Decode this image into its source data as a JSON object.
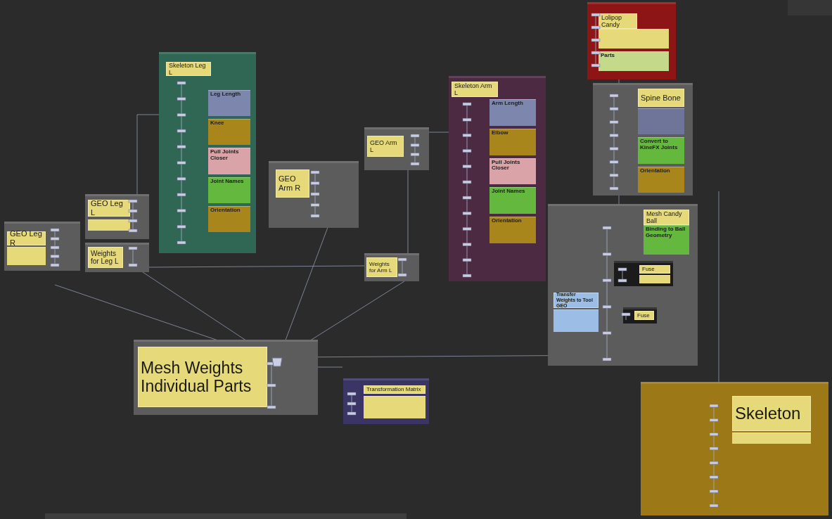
{
  "boxes": [
    {
      "kind": "frame",
      "title": "GEO Leg R",
      "color": "#5c5c5c",
      "notes": [
        {
          "color": "#e6d97a"
        }
      ]
    },
    {
      "kind": "frame",
      "title": "GEO Leg L",
      "color": "#5c5c5c",
      "notes": [
        {
          "color": "#e6d97a"
        }
      ]
    },
    {
      "kind": "frame",
      "title": "Weights for Leg L",
      "color": "#5c5c5c"
    },
    {
      "kind": "frame",
      "title": "Skeleton Leg L",
      "color": "#2f6654",
      "notes": [
        {
          "heading": "Leg Length",
          "color": "#7d86ad"
        },
        {
          "heading": "Knee",
          "color": "#a8861c"
        },
        {
          "heading": "Pull Joints Closer",
          "color": "#d9a3a8"
        },
        {
          "heading": "Joint Names",
          "color": "#64b83e"
        },
        {
          "heading": "Orientation",
          "color": "#a8861c"
        }
      ]
    },
    {
      "kind": "frame",
      "title": "GEO Arm R",
      "color": "#5c5c5c"
    },
    {
      "kind": "frame",
      "title": "GEO Arm L",
      "color": "#5c5c5c"
    },
    {
      "kind": "frame",
      "title": "Weights for Arm L",
      "color": "#5c5c5c"
    },
    {
      "kind": "frame",
      "title": "Skeleton Arm L",
      "color": "#4c2a42",
      "notes": [
        {
          "heading": "Arm Length",
          "color": "#7d86ad"
        },
        {
          "heading": "Elbow",
          "color": "#a8861c"
        },
        {
          "heading": "Pull Joints Closer",
          "color": "#d9a3a8"
        },
        {
          "heading": "Joint Names",
          "color": "#64b83e"
        },
        {
          "heading": "Orientation",
          "color": "#a8861c"
        }
      ]
    },
    {
      "kind": "frame",
      "title": "Lolipop Candy",
      "color": "#8e1515",
      "notes": [
        {
          "color": "#e6d97a"
        },
        {
          "heading": "Parts",
          "color": "#c5d98a"
        }
      ]
    },
    {
      "kind": "frame",
      "title": "Spine Bone",
      "color": "#5c5c5c",
      "notes": [
        {
          "color": "#6f7499"
        },
        {
          "heading": "Convert to KineFX Joints",
          "color": "#64b83e"
        },
        {
          "heading": "Orientation",
          "color": "#a8861c"
        }
      ]
    },
    {
      "kind": "frame",
      "title": "Mesh Candy Ball",
      "color": "#5c5c5c",
      "notes": [
        {
          "heading": "Binding to Ball Geometry",
          "color": "#64b83e"
        }
      ]
    },
    {
      "kind": "frame",
      "title": "Fuse",
      "color": "#1b1b1b",
      "notes": [
        {
          "color": "#e6d97a"
        }
      ]
    },
    {
      "kind": "frame",
      "title": "Fuse",
      "color": "#1b1b1b"
    },
    {
      "kind": "loose",
      "title": "Transfer Weights to Tool GEO",
      "color": "#9bbde6",
      "notes": [
        {
          "color": "#9bbde6"
        }
      ]
    },
    {
      "kind": "frame",
      "title": "Mesh Weights Individual Parts",
      "color": "#5c5c5c"
    },
    {
      "kind": "frame",
      "title": "Transformation Matrix",
      "color": "#3b3566",
      "notes": [
        {
          "color": "#e6d97a"
        }
      ]
    },
    {
      "kind": "frame",
      "title": "Skeleton",
      "color": "#9c7817",
      "notes": [
        {
          "color": "#e6d97a"
        }
      ]
    }
  ]
}
